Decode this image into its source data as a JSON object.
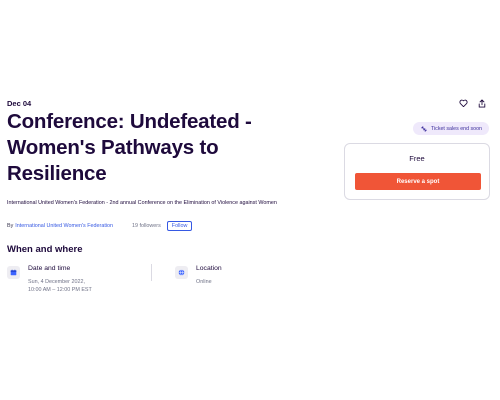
{
  "event": {
    "date_label": "Dec 04",
    "title": "Conference: Undefeated - Women's Pathways to Resilience",
    "summary": "International United Women's Federation - 2nd annual Conference on the Elimination of Violence against Women"
  },
  "actions": {
    "like_icon": "heart-icon",
    "share_icon": "share-icon"
  },
  "ticket_badge": {
    "icon": "ticket-icon",
    "label": "Ticket sales end soon"
  },
  "reserve_card": {
    "price": "Free",
    "button_label": "Reserve a spot"
  },
  "organizer": {
    "by_label": "By",
    "name": "International United Women's Federation",
    "followers": "19 followers",
    "follow_label": "Follow"
  },
  "when_where": {
    "heading": "When and where",
    "date_time": {
      "icon": "calendar-icon",
      "label": "Date and time",
      "line1": "Sun, 4 December 2022,",
      "line2": "10:00 AM – 12:00 PM EST"
    },
    "location": {
      "icon": "globe-icon",
      "label": "Location",
      "value": "Online"
    }
  },
  "colors": {
    "accent": "#f05537",
    "link": "#3659e3",
    "text": "#1e0a3c",
    "badge_bg": "#efe9fb"
  }
}
